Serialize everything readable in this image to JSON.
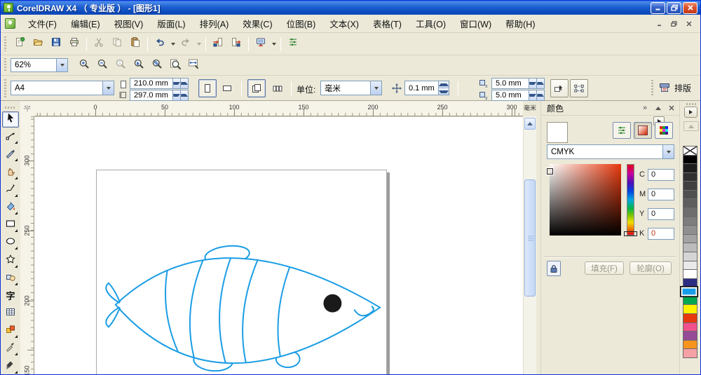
{
  "window": {
    "title": "CorelDRAW X4 （ 专业版 ） - [图形1]",
    "controls": [
      "minimize",
      "restore",
      "close"
    ]
  },
  "menu_bar": {
    "items": [
      "文件(F)",
      "编辑(E)",
      "视图(V)",
      "版面(L)",
      "排列(A)",
      "效果(C)",
      "位图(B)",
      "文本(X)",
      "表格(T)",
      "工具(O)",
      "窗口(W)",
      "帮助(H)"
    ],
    "doc_controls": [
      "minimize",
      "restore",
      "close"
    ]
  },
  "standard_toolbar": {
    "buttons": [
      {
        "name": "new"
      },
      {
        "name": "open"
      },
      {
        "name": "save"
      },
      {
        "name": "print"
      },
      {
        "name": "cut",
        "disabled": true,
        "sep_before": true
      },
      {
        "name": "copy",
        "disabled": true
      },
      {
        "name": "paste"
      },
      {
        "name": "undo",
        "dropdown": true,
        "sep_before": true
      },
      {
        "name": "redo",
        "disabled": true,
        "dropdown": true
      },
      {
        "name": "import",
        "sep_before": true
      },
      {
        "name": "export"
      },
      {
        "name": "app-launcher",
        "dropdown": true,
        "sep_before": true
      },
      {
        "name": "options",
        "sep_before": true
      }
    ]
  },
  "zoom_toolbar": {
    "zoom_level": "62%",
    "buttons": [
      {
        "name": "zoom-in"
      },
      {
        "name": "zoom-out"
      },
      {
        "name": "zoom-actual",
        "disabled": true
      },
      {
        "name": "zoom-selected"
      },
      {
        "name": "zoom-all"
      },
      {
        "name": "zoom-page"
      },
      {
        "name": "zoom-width"
      }
    ]
  },
  "property_bar": {
    "paper_size": "A4",
    "paper_width": "210.0 mm",
    "paper_height": "297.0 mm",
    "units_label": "单位:",
    "units_value": "毫米",
    "nudge_value": "0.1 mm",
    "duplicate_x": "5.0 mm",
    "duplicate_y": "5.0 mm",
    "layout_tab_label": "排版"
  },
  "rulers": {
    "horizontal_labels": [
      "0",
      "50",
      "100",
      "150",
      "200",
      "250",
      "300"
    ],
    "horizontal_unit": "毫米",
    "vertical_labels": [
      "300",
      "250",
      "200",
      "150"
    ]
  },
  "toolbox": {
    "tools": [
      {
        "name": "pick-tool",
        "active": true
      },
      {
        "name": "shape-tool",
        "flyout": true
      },
      {
        "name": "crop-tool",
        "flyout": true
      },
      {
        "name": "hand-tool",
        "flyout": true
      },
      {
        "name": "freehand-tool",
        "flyout": true
      },
      {
        "name": "smart-fill-tool",
        "flyout": true
      },
      {
        "name": "rectangle-tool",
        "flyout": true
      },
      {
        "name": "ellipse-tool",
        "flyout": true
      },
      {
        "name": "polygon-tool",
        "flyout": true
      },
      {
        "name": "basic-shapes-tool",
        "flyout": true
      },
      {
        "name": "text-tool",
        "glyph": "字"
      },
      {
        "name": "table-tool"
      },
      {
        "name": "blend-tool",
        "flyout": true
      },
      {
        "name": "eyedropper-tool",
        "flyout": true
      },
      {
        "name": "outline-tool",
        "flyout": true
      }
    ]
  },
  "color_docker": {
    "title": "颜色",
    "model": "CMYK",
    "hue": "#E8380D",
    "channels": [
      {
        "label": "C",
        "value": "0"
      },
      {
        "label": "M",
        "value": "0"
      },
      {
        "label": "Y",
        "value": "0"
      },
      {
        "label": "K",
        "value": "0",
        "highlight": true
      }
    ],
    "fill_button": "填充(F)",
    "outline_button": "轮廓(O)"
  },
  "palette": {
    "swatches": [
      {
        "name": "no-color"
      },
      {
        "color": "#000000"
      },
      {
        "color": "#1D1D1D"
      },
      {
        "color": "#303030"
      },
      {
        "color": "#404040"
      },
      {
        "color": "#4F4F4F"
      },
      {
        "color": "#5E5E5E"
      },
      {
        "color": "#6E6E6E"
      },
      {
        "color": "#7D7D7D"
      },
      {
        "color": "#8F8F8F"
      },
      {
        "color": "#A3A3A3"
      },
      {
        "color": "#BBBBBB"
      },
      {
        "color": "#D4D4D4"
      },
      {
        "color": "#E9E9E9"
      },
      {
        "color": "#FFFFFF"
      },
      {
        "color": "#2D2E83"
      },
      {
        "color": "#199CE8",
        "selected": true
      },
      {
        "color": "#00A650"
      },
      {
        "color": "#FFF100"
      },
      {
        "color": "#E8380D"
      },
      {
        "color": "#F0508C"
      },
      {
        "color": "#964B96"
      },
      {
        "color": "#F7941D"
      },
      {
        "color": "#F5A0A5"
      }
    ]
  },
  "canvas": {
    "drawing": "striped fish outline drawing",
    "fish_outline": "#1A9DE5",
    "fish_eye": "#1A1A1A"
  }
}
